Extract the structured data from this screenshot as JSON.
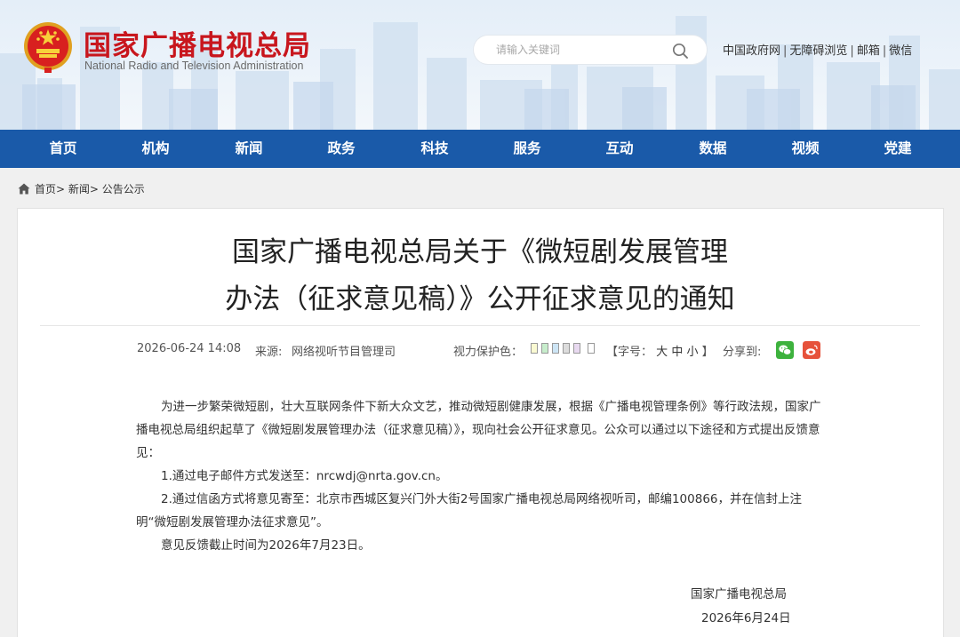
{
  "header": {
    "title_cn": "国家广播电视总局",
    "title_en": "National Radio and Television Administration",
    "search_placeholder": "请输入关键词",
    "toplinks": [
      "中国政府网",
      "无障碍浏览",
      "邮箱",
      "微信"
    ],
    "colors": {
      "brand_red": "#c8161d",
      "nav_blue": "#1a5aa9"
    },
    "icons": [
      "national-emblem-icon",
      "search-icon"
    ]
  },
  "nav": {
    "items": [
      "首页",
      "机构",
      "新闻",
      "政务",
      "科技",
      "服务",
      "互动",
      "数据",
      "视频",
      "党建"
    ]
  },
  "breadcrumb": {
    "items": [
      "首页>",
      "新闻>",
      "公告公示"
    ]
  },
  "article": {
    "title_line1": "国家广播电视总局关于《微短剧发展管理",
    "title_line2": "办法（征求意见稿）》公开征求意见的通知",
    "date": "2026-06-24 14:08",
    "source_label": "来源:",
    "source": "网络视听节目管理司",
    "eye_label": "视力保护色：",
    "eye_colors": [
      "#fafad2",
      "#c7edcc",
      "#cde5f5",
      "#dcdcdc",
      "#e8d9f0",
      "#ffffff"
    ],
    "font_open": "【字号：",
    "font_sizes": [
      "大",
      "中",
      "小"
    ],
    "font_close": "】",
    "share_label": "分享到:",
    "share_icons": [
      "wechat-icon",
      "weibo-icon"
    ],
    "paragraph1": "为进一步繁荣微短剧，壮大互联网条件下新大众文艺，推动微短剧健康发展，根据《广播电视管理条例》等行政法规，国家广播电视总局组织起草了《微短剧发展管理办法（征求意见稿）》，现向社会公开征求意见。公众可以通过以下途径和方式提出反馈意见：",
    "item1": "1.通过电子邮件方式发送至：nrcwdj@nrta.gov.cn。",
    "item2": "2.通过信函方式将意见寄至：北京市西城区复兴门外大街2号国家广播电视总局网络视听司，邮编100866，并在信封上注明“微短剧发展管理办法征求意见”。",
    "deadline": "意见反馈截止时间为2026年7月23日。",
    "signature": "国家广播电视总局",
    "sign_date": "2026年6月24日"
  }
}
